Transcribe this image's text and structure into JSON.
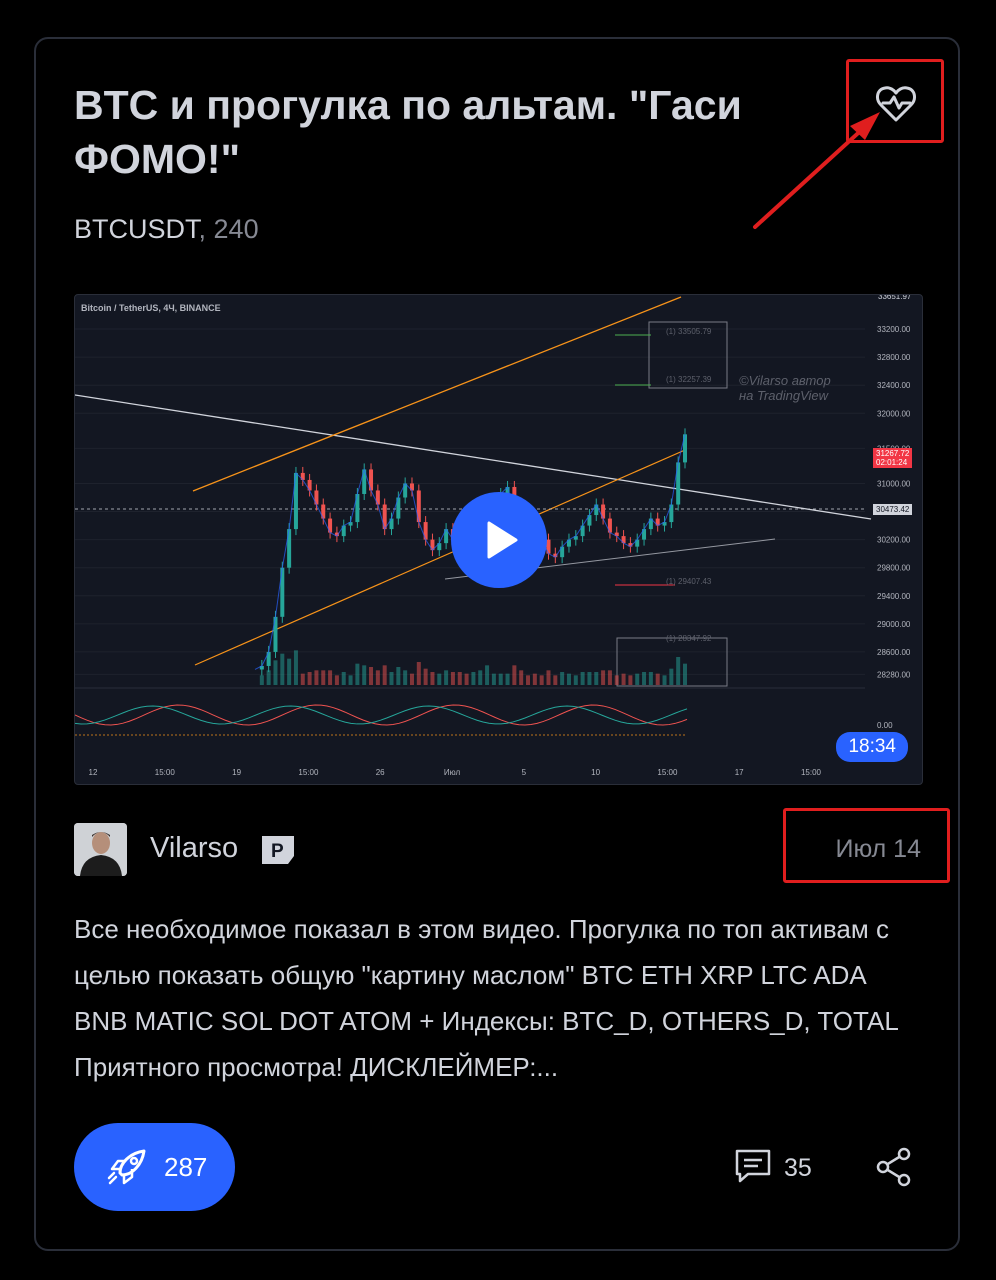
{
  "idea": {
    "title": "BTC и прогулка по альтам. \"Гаси ФОМО!\"",
    "symbol": "BTCUSDT",
    "interval_sep": ", ",
    "interval": "240",
    "author": "Vilarso",
    "author_badge": "P",
    "date": "Июл 14",
    "description": "Все необходимое показал в этом видео. Прогулка по топ активам с целью показать общую \"картину маслом\" BTC ETH XRP LTC ADA BNB MATIC SOL DOT ATOM + Индексы: BTC_D, OTHERS_D, TOTAL Приятного просмотра! ДИСКЛЕЙМЕР:...",
    "boosts": "287",
    "comments": "35"
  },
  "video": {
    "duration": "18:34",
    "chart_label": "Bitcoin / TetherUS, 4Ч, BINANCE",
    "watermark_line1": "©Vilarso автор",
    "watermark_line2": "на TradingView",
    "last_price": "31267.72",
    "countdown": "02:01:24",
    "crosshair_price": "30473.42",
    "top_price_cut": "33651.97",
    "fib_top_label": "(1) 33505.79",
    "fib_mid_label": "(1) 32257.39",
    "fib_low_label": "(1) 29407.43",
    "fib_bottom_label": "(1) 28347.92"
  },
  "chart_data": {
    "type": "line",
    "title": "Bitcoin / TetherUS, 4Ч, BINANCE",
    "y_ticks": [
      "33200.00",
      "32800.00",
      "32400.00",
      "32000.00",
      "31500.00",
      "31000.00",
      "30600.00",
      "30200.00",
      "29800.00",
      "29400.00",
      "29000.00",
      "28600.00",
      "28280.00"
    ],
    "oscillator_tick": "0.00",
    "x_ticks": [
      "12",
      "15:00",
      "19",
      "15:00",
      "26",
      "Июл",
      "5",
      "10",
      "15:00",
      "17",
      "15:00"
    ],
    "ylim": [
      28200,
      33400
    ],
    "series": [
      {
        "values": [
          28350,
          28400,
          28600,
          29100,
          29800,
          30350,
          31150,
          31050,
          30900,
          30700,
          30500,
          30300,
          30250,
          30400,
          30450,
          30850,
          31200,
          30900,
          30700,
          30350,
          30500,
          30800,
          31000,
          30900,
          30450,
          30200,
          30050,
          30150,
          30350,
          30200,
          30050,
          29950,
          30100,
          30300,
          30650,
          30750,
          30850,
          30950,
          30600,
          30400,
          30350,
          30250,
          30200,
          30000,
          29950,
          30100,
          30200,
          30250,
          30400,
          30550,
          30700,
          30500,
          30300,
          30250,
          30150,
          30100,
          30200,
          30350,
          30500,
          30400,
          30450,
          30700,
          31300,
          31700
        ]
      }
    ]
  }
}
